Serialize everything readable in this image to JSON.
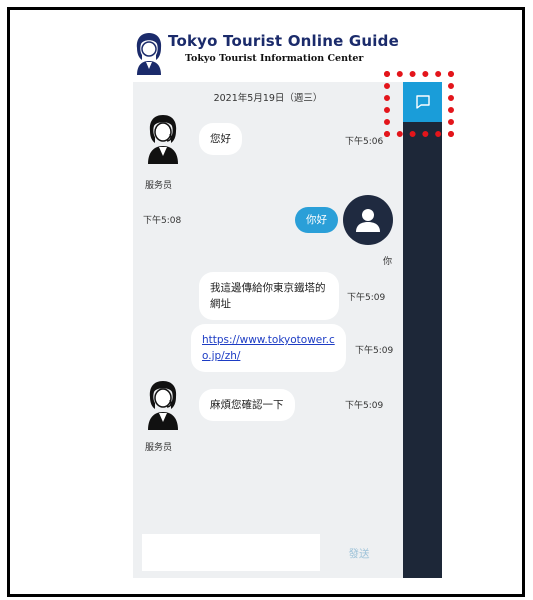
{
  "header": {
    "title": "Tokyo Tourist Online Guide",
    "subtitle": "Tokyo Tourist Information Center"
  },
  "chat": {
    "date": "2021年5月19日（週三）",
    "messages": [
      {
        "sender": "服务员",
        "text": "您好",
        "time": "下午5:06"
      },
      {
        "sender": "你",
        "text": "你好",
        "time": "下午5:08"
      },
      {
        "sender": "服务员",
        "text": "我這邊傳給你東京鐵塔的網址",
        "time": "下午5:09"
      },
      {
        "sender": "服务员",
        "link": "https://www.tokyotower.co.jp/zh/",
        "time": "下午5:09"
      },
      {
        "sender": "服务员",
        "text": "麻煩您確認一下",
        "time": "下午5:09"
      }
    ],
    "input_placeholder": "",
    "send_label": "發送"
  },
  "colors": {
    "accent": "#1a9dd9",
    "sidebar": "#1d2738",
    "user_bubble": "#2a9fd8",
    "highlight": "#e3151b"
  },
  "icons": [
    "agent-avatar-icon",
    "user-avatar-icon",
    "chat-bubble-icon",
    "logo-icon"
  ]
}
